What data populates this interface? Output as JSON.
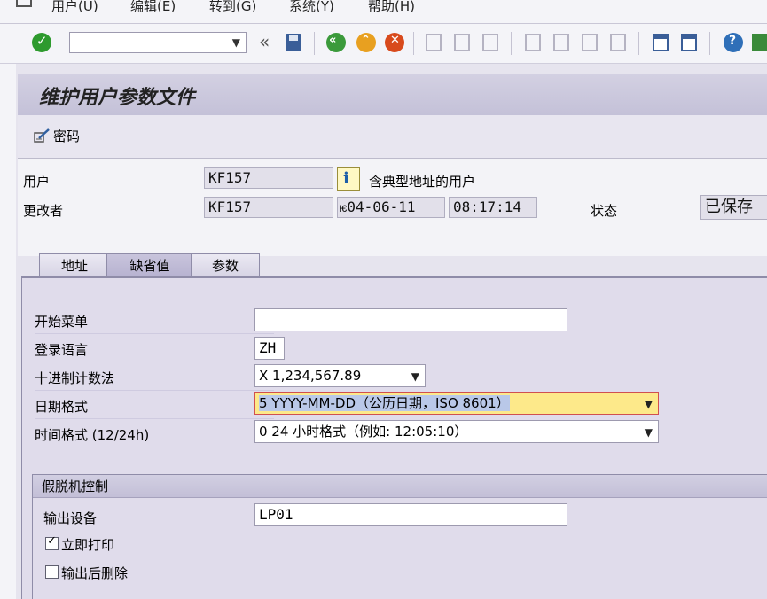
{
  "menu": [
    "用户(U)",
    "编辑(E)",
    "转到(G)",
    "系统(Y)",
    "帮助(H)"
  ],
  "toolbar": {
    "command_value": "",
    "collapse_glyph": "«"
  },
  "page_title": "维护用户参数文件",
  "subbar": {
    "password_label": "密码"
  },
  "header": {
    "user_label": "用户",
    "user_value": "KF157",
    "user_desc": "含典型地址的用户",
    "changed_by_label": "更改者",
    "changed_by_value": "KF157",
    "changed_date": "04-06-11",
    "changed_date_prefix": "ѥ",
    "changed_time": "08:17:14",
    "status_label": "状态",
    "status_value": "已保存"
  },
  "tabs": [
    {
      "label": "地址",
      "active": false
    },
    {
      "label": "缺省值",
      "active": true
    },
    {
      "label": "参数",
      "active": false
    }
  ],
  "defaults": {
    "start_menu_label": "开始菜单",
    "start_menu_value": "",
    "logon_lang_label": "登录语言",
    "logon_lang_value": "ZH",
    "decimal_label": "十进制计数法",
    "decimal_value": "X 1,234,567.89",
    "date_format_label": "日期格式",
    "date_format_value": "5 YYYY-MM-DD（公历日期，ISO 8601）",
    "time_format_label": "时间格式 (12/24h)",
    "time_format_value": "0 24 小时格式（例如: 12:05:10）"
  },
  "spool": {
    "title": "假脱机控制",
    "output_device_label": "输出设备",
    "output_device_value": "LP01",
    "print_immediately_label": "立即打印",
    "print_immediately_checked": true,
    "delete_after_output_label": "输出后删除",
    "delete_after_output_checked": false
  },
  "colors": {
    "accent": "#c4c1d8",
    "highlight": "#fde98a",
    "ok_green": "#2e9a2e"
  }
}
